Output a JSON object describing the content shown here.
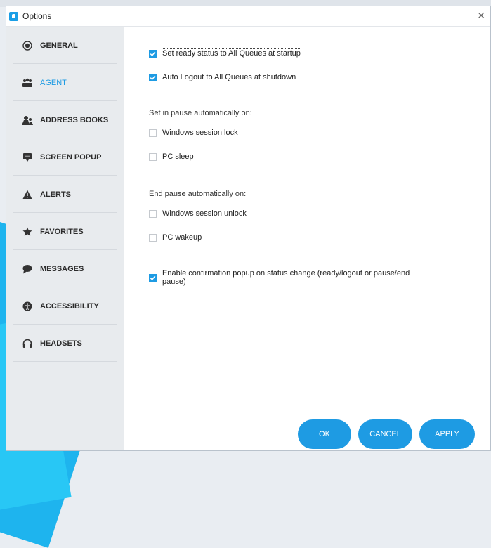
{
  "window": {
    "title": "Options"
  },
  "sidebar": {
    "items": [
      {
        "label": "GENERAL",
        "icon": "general-icon",
        "active": false
      },
      {
        "label": "AGENT",
        "icon": "agent-icon",
        "active": true
      },
      {
        "label": "ADDRESS BOOKS",
        "icon": "address-books-icon",
        "active": false
      },
      {
        "label": "SCREEN POPUP",
        "icon": "screen-popup-icon",
        "active": false
      },
      {
        "label": "ALERTS",
        "icon": "alert-icon",
        "active": false
      },
      {
        "label": "FAVORITES",
        "icon": "star-icon",
        "active": false
      },
      {
        "label": "MESSAGES",
        "icon": "message-icon",
        "active": false
      },
      {
        "label": "ACCESSIBILITY",
        "icon": "accessibility-icon",
        "active": false
      },
      {
        "label": "HEADSETS",
        "icon": "headset-icon",
        "active": false
      }
    ]
  },
  "agent": {
    "ready_at_startup": {
      "label": "Set ready status to All Queues at startup",
      "checked": true
    },
    "logout_at_shutdown": {
      "label": "Auto Logout to All Queues at shutdown",
      "checked": true
    },
    "pause_heading": "Set in pause automatically on:",
    "pause_on_lock": {
      "label": "Windows session lock",
      "checked": false
    },
    "pause_on_sleep": {
      "label": "PC sleep",
      "checked": false
    },
    "end_pause_heading": "End pause automatically on:",
    "end_on_unlock": {
      "label": "Windows session unlock",
      "checked": false
    },
    "end_on_wakeup": {
      "label": "PC wakeup",
      "checked": false
    },
    "confirm_popup": {
      "label": "Enable confirmation popup on status change (ready/logout or pause/end pause)",
      "checked": true
    }
  },
  "buttons": {
    "ok": "OK",
    "cancel": "CANCEL",
    "apply": "APPLY"
  },
  "colors": {
    "accent": "#1e9be3",
    "sidebar_bg": "#e8ebee"
  }
}
